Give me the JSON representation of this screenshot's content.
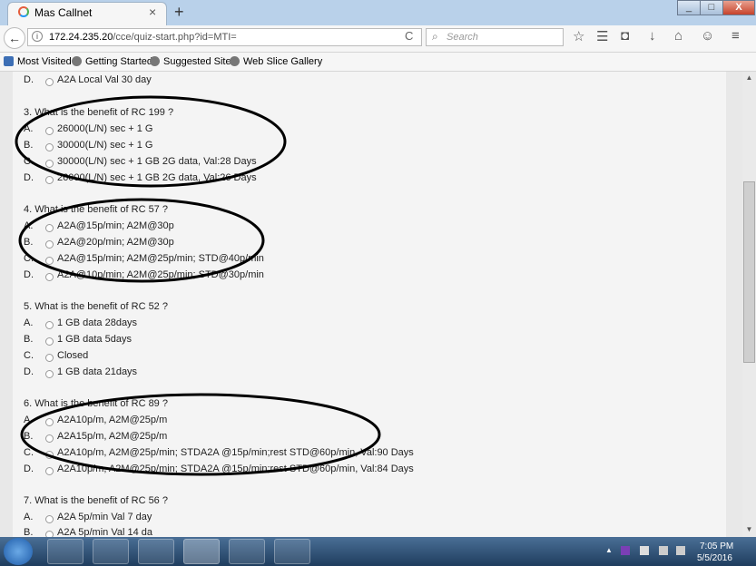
{
  "window": {
    "tab_title": "Mas Callnet",
    "close_tab": "×",
    "new_tab": "+",
    "minimize": "_",
    "maximize": "□",
    "close_window": "X"
  },
  "navbar": {
    "url_host": "172.24.235.20",
    "url_path": "/cce/quiz-start.php?id=MTI=",
    "search_placeholder": "Search",
    "back": "←",
    "reload": "C",
    "search_icon": "⌕"
  },
  "bookmarks": [
    "Most Visited",
    "Getting Started",
    "Suggested Sites",
    "Web Slice Gallery"
  ],
  "quiz": {
    "prev_option": {
      "letter": "D.",
      "text": "A2A Local Val 30 day"
    },
    "questions": [
      {
        "title": "3. What is the benefit of RC 199 ?",
        "options": [
          {
            "letter": "A.",
            "text": "26000(L/N) sec + 1 G"
          },
          {
            "letter": "B.",
            "text": "30000(L/N) sec + 1 G"
          },
          {
            "letter": "C.",
            "text": "30000(L/N) sec + 1 GB 2G data, Val:28 Days"
          },
          {
            "letter": "D.",
            "text": "26000(L/N) sec + 1 GB 2G data, Val:26 Days"
          }
        ]
      },
      {
        "title": "4. What is the benefit of RC 57 ?",
        "options": [
          {
            "letter": "A.",
            "text": "A2A@15p/min; A2M@30p"
          },
          {
            "letter": "B.",
            "text": "A2A@20p/min; A2M@30p"
          },
          {
            "letter": "C.",
            "text": "A2A@15p/min; A2M@25p/min; STD@40p/min"
          },
          {
            "letter": "D.",
            "text": "A2A@10p/min; A2M@25p/min; STD@30p/min"
          }
        ]
      },
      {
        "title": "5. What is the benefit of RC 52 ?",
        "options": [
          {
            "letter": "A.",
            "text": "1 GB data 28days"
          },
          {
            "letter": "B.",
            "text": "1 GB data 5days"
          },
          {
            "letter": "C.",
            "text": "Closed"
          },
          {
            "letter": "D.",
            "text": "1 GB data 21days"
          }
        ]
      },
      {
        "title": "6. What is the benefit of RC 89 ?",
        "options": [
          {
            "letter": "A.",
            "text": "A2A10p/m, A2M@25p/m"
          },
          {
            "letter": "B.",
            "text": "A2A15p/m, A2M@25p/m"
          },
          {
            "letter": "C.",
            "text": "A2A10p/m, A2M@25p/min; STDA2A @15p/min;rest STD@60p/min, Val:90 Days"
          },
          {
            "letter": "D.",
            "text": "A2A10p/m, A2M@25p/min; STDA2A @15p/min;rest STD@60p/min, Val:84 Days"
          }
        ]
      },
      {
        "title": "7. What is the benefit of RC 56 ?",
        "options": [
          {
            "letter": "A.",
            "text": "A2A 5p/min Val 7 day"
          },
          {
            "letter": "B.",
            "text": "A2A 5p/min Val 14 da"
          }
        ]
      }
    ]
  },
  "taskbar": {
    "time": "7:05 PM",
    "date": "5/5/2016"
  }
}
